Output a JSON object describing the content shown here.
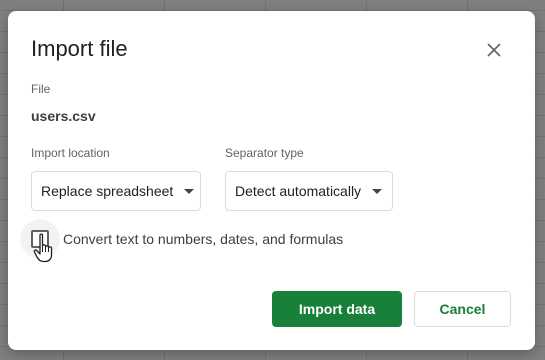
{
  "dialog": {
    "title": "Import file",
    "file_label": "File",
    "file_name": "users.csv",
    "import_location": {
      "label": "Import location",
      "value": "Replace spreadsheet"
    },
    "separator_type": {
      "label": "Separator type",
      "value": "Detect automatically"
    },
    "convert_checkbox": {
      "label": "Convert text to numbers, dates, and formulas",
      "checked": false
    },
    "buttons": {
      "import": "Import data",
      "cancel": "Cancel"
    }
  },
  "colors": {
    "primary": "#188038",
    "overlay": "#7f7f7f",
    "text": "#202124"
  }
}
